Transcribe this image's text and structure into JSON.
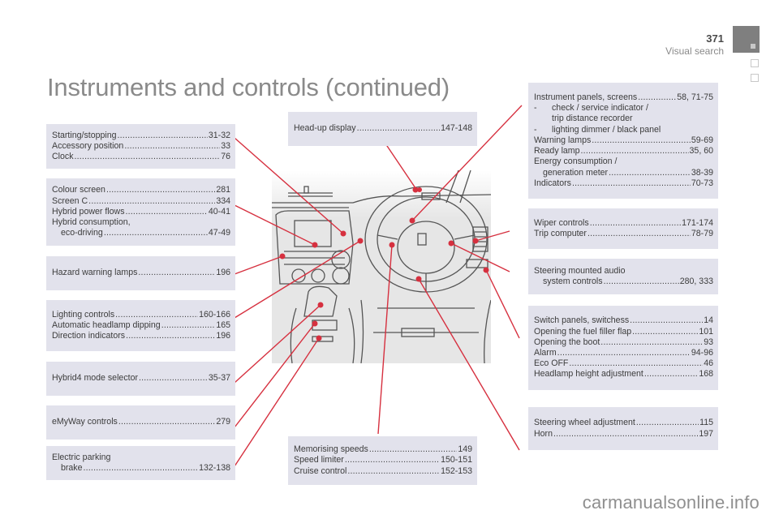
{
  "header": {
    "page_number": "371",
    "section": "Visual search",
    "title": "Instruments and controls (continued)"
  },
  "colors": {
    "box_bg": "#e2e2ec",
    "callout_line": "#d6303f",
    "title_gray": "#8a8a8a",
    "tab_dark": "#7f7f7f"
  },
  "boxes": {
    "starting": [
      {
        "label": "Starting/stopping",
        "page": "31-32"
      },
      {
        "label": "Accessory position",
        "page": "33"
      },
      {
        "label": "Clock",
        "page": "76"
      }
    ],
    "colour_screen": [
      {
        "label": "Colour screen ",
        "page": "281"
      },
      {
        "label": "Screen C",
        "page": "334"
      },
      {
        "label": "Hybrid power flows ",
        "page": "40-41"
      },
      {
        "label": "Hybrid consumption,",
        "page": ""
      },
      {
        "label": "eco-driving",
        "page": "47-49"
      }
    ],
    "hazard": [
      {
        "label": "Hazard warning lamps",
        "page": "196"
      }
    ],
    "lighting": [
      {
        "label": "Lighting controls ",
        "page": "160-166"
      },
      {
        "label": "Automatic headlamp dipping ",
        "page": "165"
      },
      {
        "label": "Direction indicators",
        "page": "196"
      }
    ],
    "hybrid4": [
      {
        "label": "Hybrid4 mode selector",
        "page": "35-37"
      }
    ],
    "emyway": [
      {
        "label": "eMyWay controls ",
        "page": "279"
      }
    ],
    "parking_brake": [
      {
        "label": "Electric parking",
        "page": ""
      },
      {
        "label": "brake ",
        "page": "132-138"
      }
    ],
    "head_up": [
      {
        "label": "Head-up display",
        "page": "147-148"
      }
    ],
    "speeds": [
      {
        "label": "Memorising speeds ",
        "page": "149"
      },
      {
        "label": "Speed limiter",
        "page": "150-151"
      },
      {
        "label": "Cruise control ",
        "page": "152-153"
      }
    ],
    "instrument_panels": [
      {
        "label": "Instrument panels, screens ",
        "page": "58, 71-75"
      },
      {
        "label": "check / service indicator /",
        "page": ""
      },
      {
        "label": "trip distance recorder",
        "page": ""
      },
      {
        "label": "lighting dimmer / black panel",
        "page": ""
      },
      {
        "label": "Warning lamps",
        "page": "59-69"
      },
      {
        "label": "Ready lamp ",
        "page": "35, 60"
      },
      {
        "label": "Energy consumption /",
        "page": ""
      },
      {
        "label": "generation meter ",
        "page": "38-39"
      },
      {
        "label": "Indicators",
        "page": "70-73"
      }
    ],
    "dash_marker": "-",
    "wiper": [
      {
        "label": "Wiper controls",
        "page": "171-174"
      },
      {
        "label": "Trip computer ",
        "page": "78-79"
      }
    ],
    "steering_audio": [
      {
        "label": "Steering mounted audio",
        "page": ""
      },
      {
        "label": "system controls ",
        "page": "280, 333"
      }
    ],
    "switch_panels": [
      {
        "label": "Switch panels, switchess",
        "page": "14"
      },
      {
        "label": "Opening the fuel filler flap",
        "page": "101"
      },
      {
        "label": "Opening the boot",
        "page": "93"
      },
      {
        "label": "Alarm ",
        "page": "94-96"
      },
      {
        "label": "Eco OFF ",
        "page": "46"
      },
      {
        "label": "Headlamp height adjustment",
        "page": "168"
      }
    ],
    "steering_wheel": [
      {
        "label": "Steering wheel adjustment ",
        "page": "115"
      },
      {
        "label": "Horn",
        "page": "197"
      }
    ]
  },
  "illustration": {
    "subject": "dashboard-cockpit-line-drawing"
  },
  "watermark": "carmanualsonline.info"
}
